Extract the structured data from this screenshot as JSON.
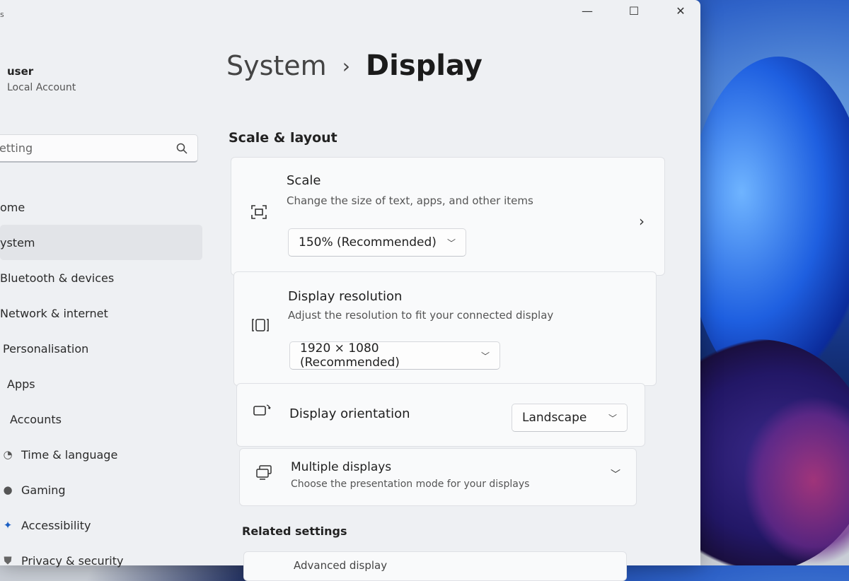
{
  "window": {
    "app_corner": "s"
  },
  "titlebar": {
    "minimize": "—",
    "maximize": "☐",
    "close": "✕"
  },
  "user": {
    "name": "user",
    "account_type": "Local Account"
  },
  "search": {
    "placeholder": "etting"
  },
  "sidebar": {
    "items": [
      {
        "label": "ome",
        "icon": "home-icon"
      },
      {
        "label": "ystem",
        "icon": "system-icon",
        "selected": true
      },
      {
        "label": "Bluetooth & devices",
        "icon": "bluetooth-icon"
      },
      {
        "label": "Network & internet",
        "icon": "network-icon"
      },
      {
        "label": "Personalisation",
        "icon": "brush-icon"
      },
      {
        "label": "Apps",
        "icon": "apps-icon"
      },
      {
        "label": "Accounts",
        "icon": "person-icon"
      },
      {
        "label": "Time & language",
        "icon": "clock-icon"
      },
      {
        "label": "Gaming",
        "icon": "gamepad-icon"
      },
      {
        "label": "Accessibility",
        "icon": "accessibility-icon"
      },
      {
        "label": "Privacy & security",
        "icon": "shield-icon"
      }
    ]
  },
  "breadcrumb": {
    "parent": "System",
    "separator": "›",
    "current": "Display"
  },
  "scale_layout": {
    "title": "Scale & layout",
    "scale": {
      "title": "Scale",
      "description": "Change the size of text, apps, and other items",
      "value": "150% (Recommended)"
    },
    "resolution": {
      "title": "Display resolution",
      "description": "Adjust the resolution to fit your connected display",
      "value": "1920 × 1080 (Recommended)"
    },
    "orientation": {
      "title": "Display orientation",
      "value": "Landscape"
    },
    "multiple": {
      "title": "Multiple displays",
      "description": "Choose the presentation mode for your displays"
    }
  },
  "related": {
    "title": "Related settings",
    "advanced_label": "Advanced display"
  }
}
